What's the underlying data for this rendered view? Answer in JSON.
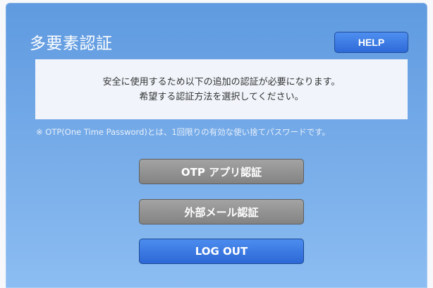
{
  "header": {
    "title": "多要素認証",
    "help_label": "HELP"
  },
  "notice": {
    "line1": "安全に使用するため以下の追加の認証が必要になります。",
    "line2": "希望する認証方法を選択してください。"
  },
  "footnote": "※ OTP(One Time Password)とは、1回限りの有効な使い捨てパスワードです。",
  "buttons": {
    "otp_app": "OTP アプリ認証",
    "external_mail": "外部メール認証",
    "logout": "LOG OUT"
  },
  "colors": {
    "panel_top": "#5f9ae0",
    "panel_bottom": "#8cbdf2",
    "primary_button": "#2e6ad8",
    "secondary_button": "#8f8f8f",
    "notice_background": "#f1f5fb"
  }
}
